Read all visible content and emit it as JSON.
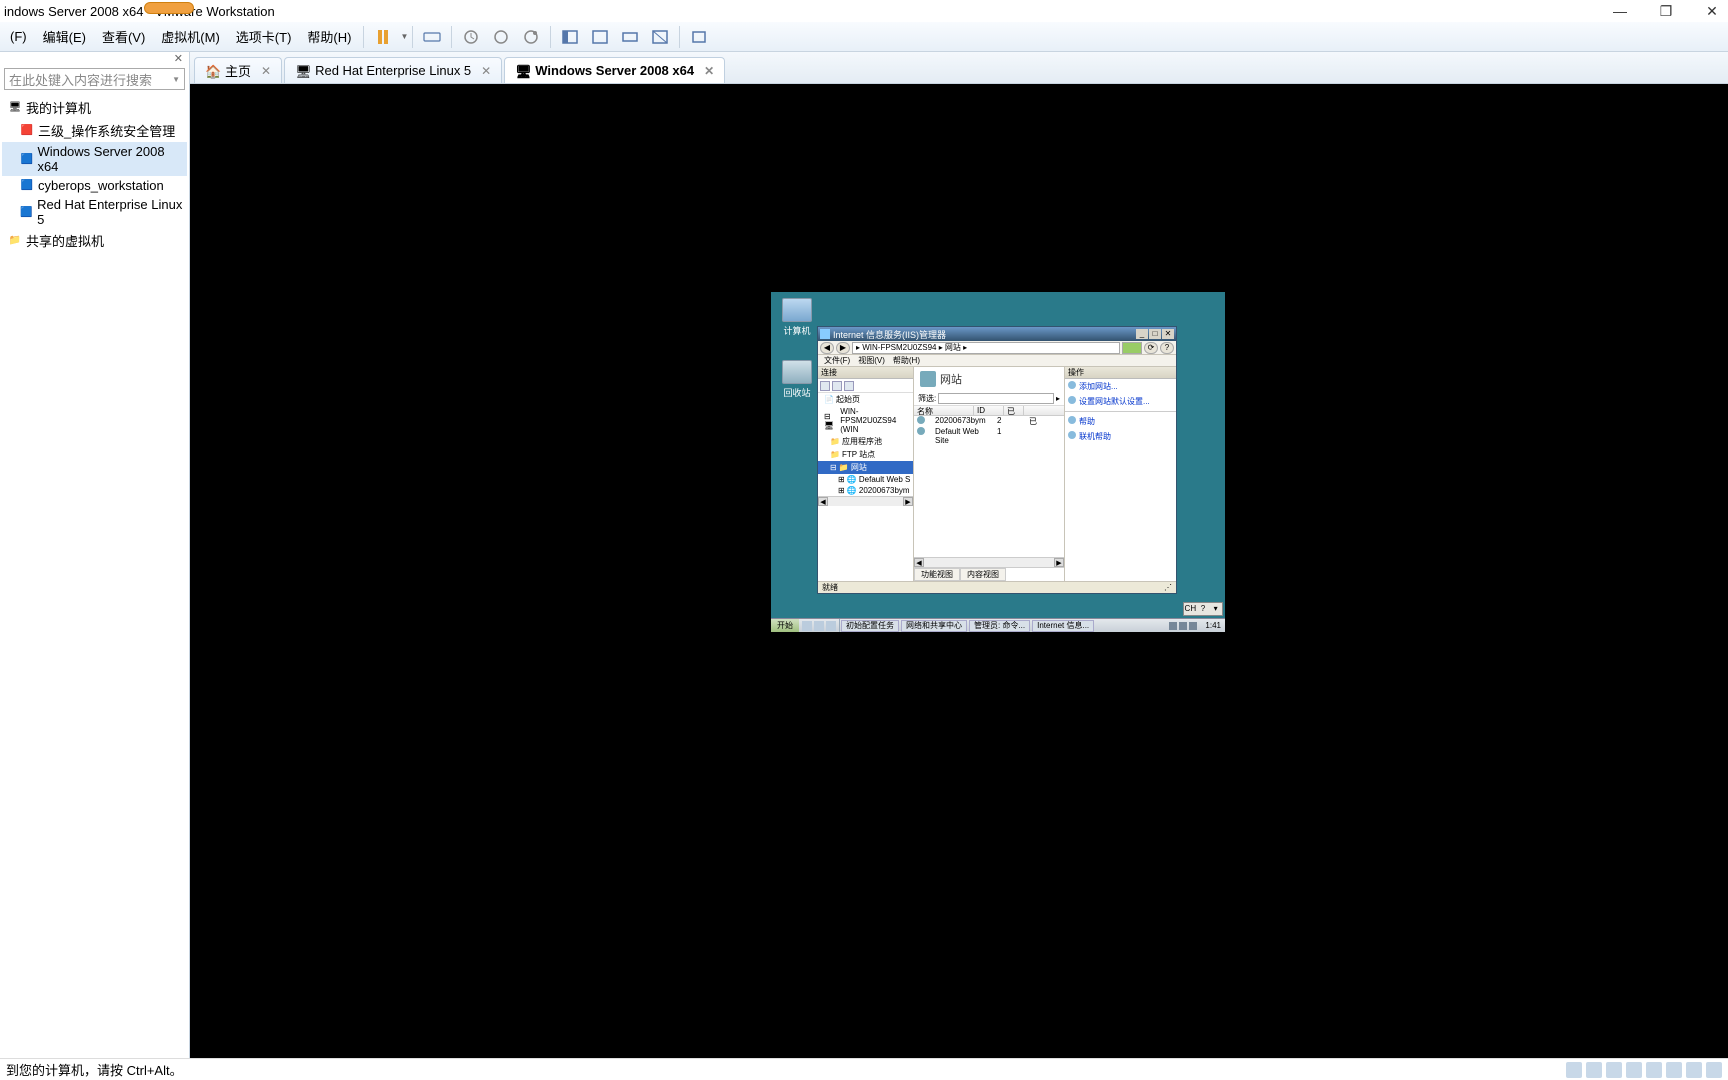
{
  "title": "indows Server 2008 x64 - VMware Workstation",
  "menus": [
    "(F)",
    "编辑(E)",
    "查看(V)",
    "虚拟机(M)",
    "选项卡(T)",
    "帮助(H)"
  ],
  "sidebar": {
    "search_placeholder": "在此处键入内容进行搜索",
    "root": "我的计算机",
    "items": [
      "三级_操作系统安全管理",
      "Windows Server 2008 x64",
      "cyberops_workstation",
      "Red Hat Enterprise Linux 5"
    ],
    "shared": "共享的虚拟机"
  },
  "tabs": [
    {
      "label": "主页",
      "icon": "home"
    },
    {
      "label": "Red Hat Enterprise Linux 5",
      "icon": "vm"
    },
    {
      "label": "Windows Server 2008 x64",
      "icon": "vm",
      "active": true
    }
  ],
  "vm": {
    "desktop_icons": {
      "computer": "计算机",
      "recycle": "回收站"
    },
    "iis": {
      "title": "Internet 信息服务(IIS)管理器",
      "breadcrumb": "▸ WIN-FPSM2U0ZS94 ▸ 网站 ▸",
      "menus": [
        "文件(F)",
        "视图(V)",
        "帮助(H)"
      ],
      "tree_header": "连接",
      "tree": {
        "start": "起始页",
        "server": "WIN-FPSM2U0ZS94 (WIN",
        "app_pools": "应用程序池",
        "ftp": "FTP 站点",
        "sites": "网站",
        "site1": "Default Web S",
        "site2": "20200673bym"
      },
      "main_title": "网站",
      "filter_label": "筛选:",
      "columns": {
        "name": "名称",
        "id": "ID",
        "status": "已"
      },
      "rows": [
        {
          "name": "20200673bym",
          "id": "2",
          "status": "已"
        },
        {
          "name": "Default Web Site",
          "id": "1",
          "status": ""
        }
      ],
      "view_tabs": [
        "功能视图",
        "内容视图"
      ],
      "actions_header": "操作",
      "actions": [
        "添加网站...",
        "设置网站默认设置...",
        "帮助",
        "联机帮助"
      ],
      "status": "就绪"
    },
    "taskbar": {
      "start": "开始",
      "tasks": [
        "初始配置任务",
        "网络和共享中心",
        "管理员: 命令...",
        "Internet 信息..."
      ],
      "clock": "1:41"
    }
  },
  "statusbar": "到您的计算机，请按 Ctrl+Alt。"
}
